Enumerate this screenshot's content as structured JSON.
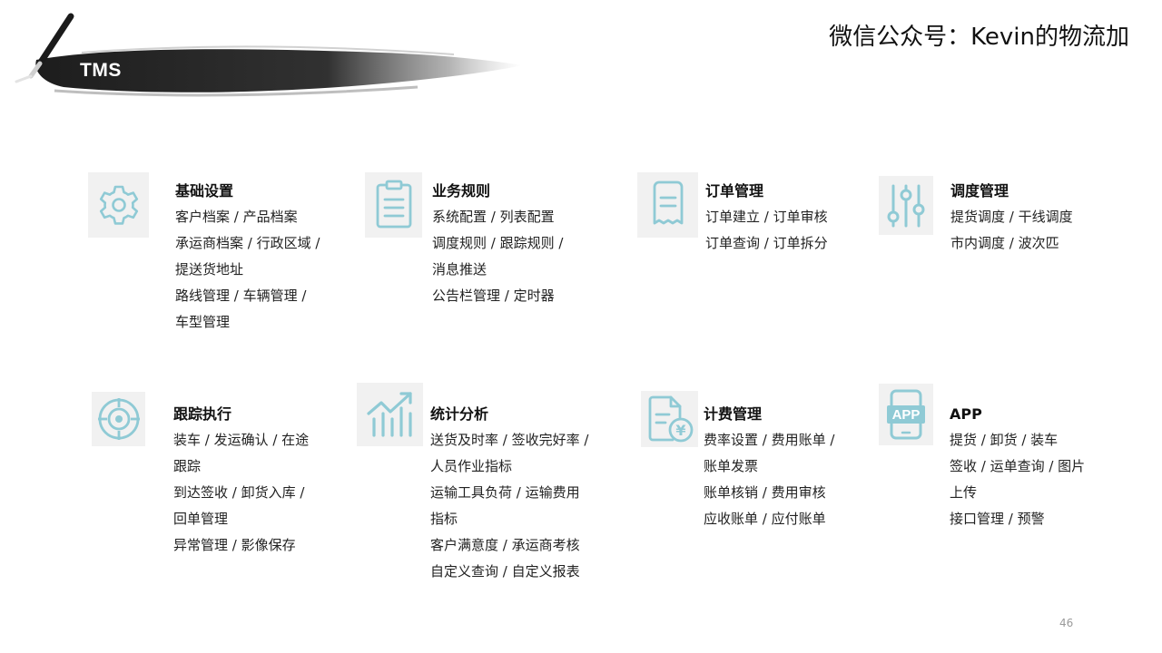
{
  "header": {
    "tms_label": "TMS",
    "title": "微信公众号：Kevin的物流加"
  },
  "accent_color": "#8fcad5",
  "cards": [
    {
      "title": "基础设置",
      "icon": "gear-icon",
      "lines": [
        "客户档案 / 产品档案",
        "承运商档案 / 行政区域 /",
        "提送货地址",
        "路线管理 / 车辆管理 /",
        "车型管理"
      ]
    },
    {
      "title": "业务规则",
      "icon": "document-list-icon",
      "lines": [
        "系统配置 / 列表配置",
        "调度规则 / 跟踪规则 /",
        "消息推送",
        "公告栏管理 / 定时器"
      ]
    },
    {
      "title": "订单管理",
      "icon": "receipt-icon",
      "lines": [
        "订单建立 / 订单审核",
        "订单查询 / 订单拆分"
      ]
    },
    {
      "title": "调度管理",
      "icon": "sliders-icon",
      "lines": [
        "提货调度 / 干线调度",
        "市内调度 / 波次匹"
      ]
    },
    {
      "title": "跟踪执行",
      "icon": "target-icon",
      "lines": [
        "装车 / 发运确认 / 在途",
        "跟踪",
        "到达签收 / 卸货入库 /",
        "回单管理",
        "异常管理 / 影像保存"
      ]
    },
    {
      "title": "统计分析",
      "icon": "bar-chart-trend-icon",
      "lines": [
        "送货及时率 / 签收完好率 /",
        "人员作业指标",
        "运输工具负荷 / 运输费用",
        "指标",
        "客户满意度 / 承运商考核",
        "自定义查询 / 自定义报表"
      ]
    },
    {
      "title": "计费管理",
      "icon": "invoice-yen-icon",
      "lines": [
        "费率设置 / 费用账单 /",
        "账单发票",
        "账单核销 / 费用审核",
        "应收账单 / 应付账单"
      ]
    },
    {
      "title": "APP",
      "icon": "mobile-app-icon",
      "icon_text": "APP",
      "lines": [
        "提货 / 卸货 / 装车",
        "签收 / 运单查询 / 图片",
        "上传",
        "接口管理 / 预警"
      ]
    }
  ],
  "page_number": "46"
}
